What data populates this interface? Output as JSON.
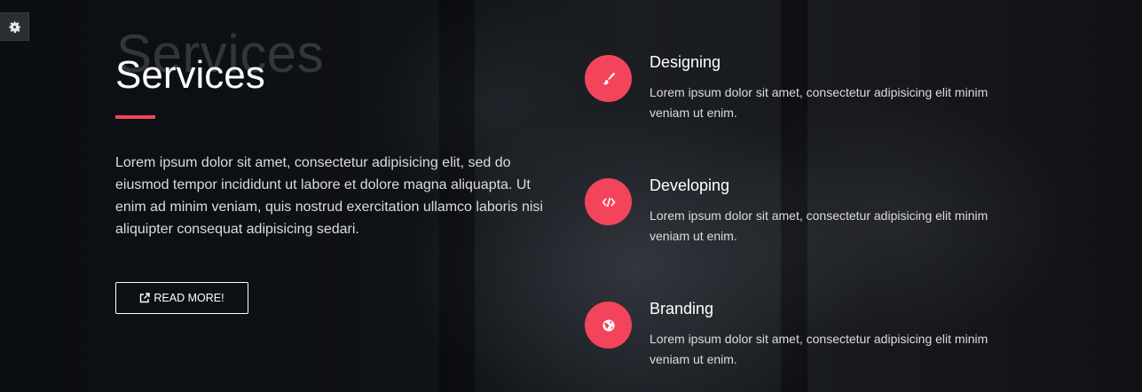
{
  "section": {
    "ghost_title": "Services",
    "title": "Services",
    "intro": "Lorem ipsum dolor sit amet, consectetur adipisicing elit, sed do eiusmod tempor incididunt ut labore et dolore magna aliquapta. Ut enim ad minim veniam, quis nostrud exercitation ullamco laboris nisi aliquipter consequat adipisicing sedari.",
    "button_label": "READ MORE!",
    "button_icon": "external-link-icon"
  },
  "settings": {
    "icon": "gear-icon"
  },
  "services": [
    {
      "title": "Designing",
      "description": "Lorem ipsum dolor sit amet, consectetur adipisicing elit minim veniam ut enim.",
      "icon": "paintbrush-icon"
    },
    {
      "title": "Developing",
      "description": "Lorem ipsum dolor sit amet, consectetur adipisicing elit minim veniam ut enim.",
      "icon": "code-icon"
    },
    {
      "title": "Branding",
      "description": "Lorem ipsum dolor sit amet, consectetur adipisicing elit minim veniam ut enim.",
      "icon": "globe-icon"
    }
  ],
  "colors": {
    "accent": "#f2455c",
    "background": "#0f1216",
    "text": "#dcdcdc"
  }
}
